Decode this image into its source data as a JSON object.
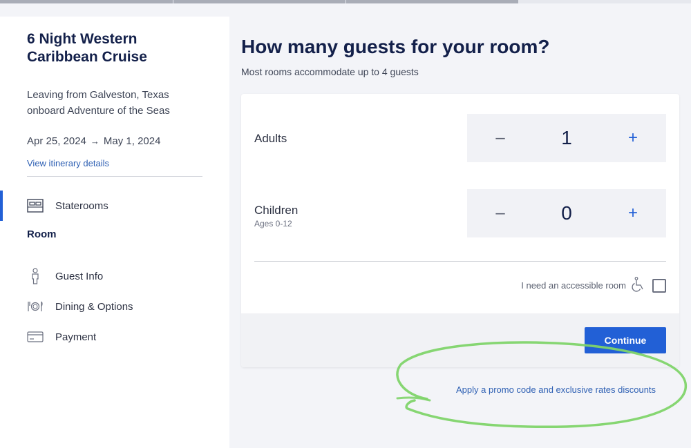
{
  "sidebar": {
    "cruise_title": "6 Night Western Caribbean Cruise",
    "departure_line1": "Leaving from Galveston, Texas",
    "departure_line2": "onboard Adventure of the Seas",
    "date_start": "Apr 25, 2024",
    "date_end": "May 1, 2024",
    "itinerary_link": "View itinerary details",
    "nav": {
      "staterooms": "Staterooms",
      "room": "Room",
      "guest_info": "Guest Info",
      "dining": "Dining & Options",
      "payment": "Payment"
    },
    "icons": [
      "bed-icon",
      "person-icon",
      "dining-icon",
      "card-icon"
    ]
  },
  "main": {
    "title": "How many guests for your room?",
    "subtitle": "Most rooms accommodate up to 4 guests",
    "adults": {
      "label": "Adults",
      "value": "1"
    },
    "children": {
      "label": "Children",
      "sublabel": "Ages 0-12",
      "value": "0"
    },
    "stepper": {
      "minus": "–",
      "plus": "+"
    },
    "accessible_label": "I need an accessible room",
    "continue_label": "Continue",
    "promo_link": "Apply a promo code and exclusive rates discounts"
  },
  "colors": {
    "accent": "#2260d6",
    "title": "#13204a",
    "annotation": "#7fd46a"
  }
}
